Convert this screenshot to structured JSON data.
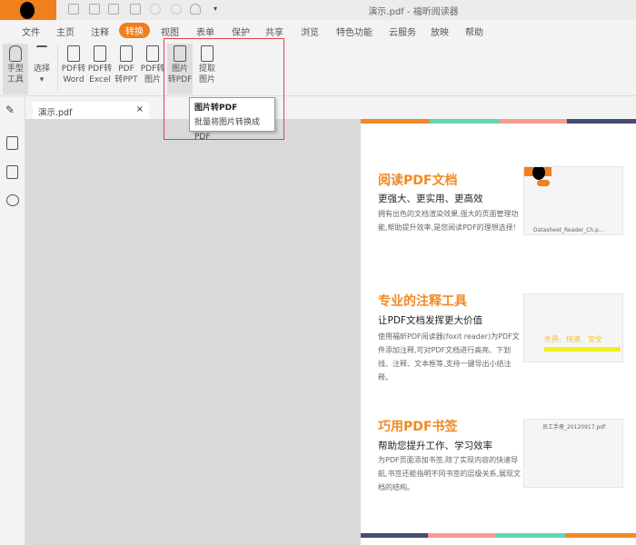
{
  "window": {
    "title": "演示.pdf - 福昕阅读器"
  },
  "menu": [
    "文件",
    "主页",
    "注释",
    "转换",
    "视图",
    "表单",
    "保护",
    "共享",
    "浏览",
    "特色功能",
    "云服务",
    "放映",
    "帮助"
  ],
  "menu_active": "转换",
  "ribbon": {
    "hand": [
      "手型",
      "工具"
    ],
    "select": [
      "选择",
      "▾"
    ],
    "pdf_word": [
      "PDF转",
      "Word"
    ],
    "pdf_excel": [
      "PDF转",
      "Excel"
    ],
    "pdf_ppt": [
      "PDF",
      "转PPT"
    ],
    "pdf_img": [
      "PDF转",
      "图片"
    ],
    "img_pdf": [
      "图片",
      "转PDF"
    ],
    "extract": [
      "提取",
      "图片"
    ]
  },
  "tooltip": {
    "title": "图片转PDF",
    "desc": "批量将图片转换成PDF"
  },
  "tab": {
    "name": "演示.pdf",
    "close": "×"
  },
  "page": {
    "sections": [
      {
        "title": "阅读PDF文档",
        "sub": "更强大、更实用、更高效",
        "body": "拥有出色的文档渲染效果,强大的页面管理功能,帮助提升效率,是您阅读PDF的理想选择!",
        "thumb": "Datasheet_Reader_Ch.p..."
      },
      {
        "title": "专业的注释工具",
        "sub": "让PDF文档发挥更大价值",
        "body": "使用福昕PDF阅读器(foxit reader)为PDF文件添加注释,可对PDF文档进行高亮、下划线、注释、文本框等,支持一键导出小结注释。",
        "thumb": "免费、快速、安全"
      },
      {
        "title": "巧用PDF书签",
        "sub": "帮助您提升工作、学习效率",
        "body": "为PDF页面添加书签,除了实现内容的快速导航,书签还能指明不同书签的层级关系,展现文档的结构。",
        "thumb": "员工手册_20120917.pdf"
      }
    ]
  },
  "colors": {
    "accent": "#f07f1d",
    "red": "#e0424e",
    "teal": "#5fd6b6",
    "salmon": "#f59c8d",
    "navy": "#454c77"
  }
}
